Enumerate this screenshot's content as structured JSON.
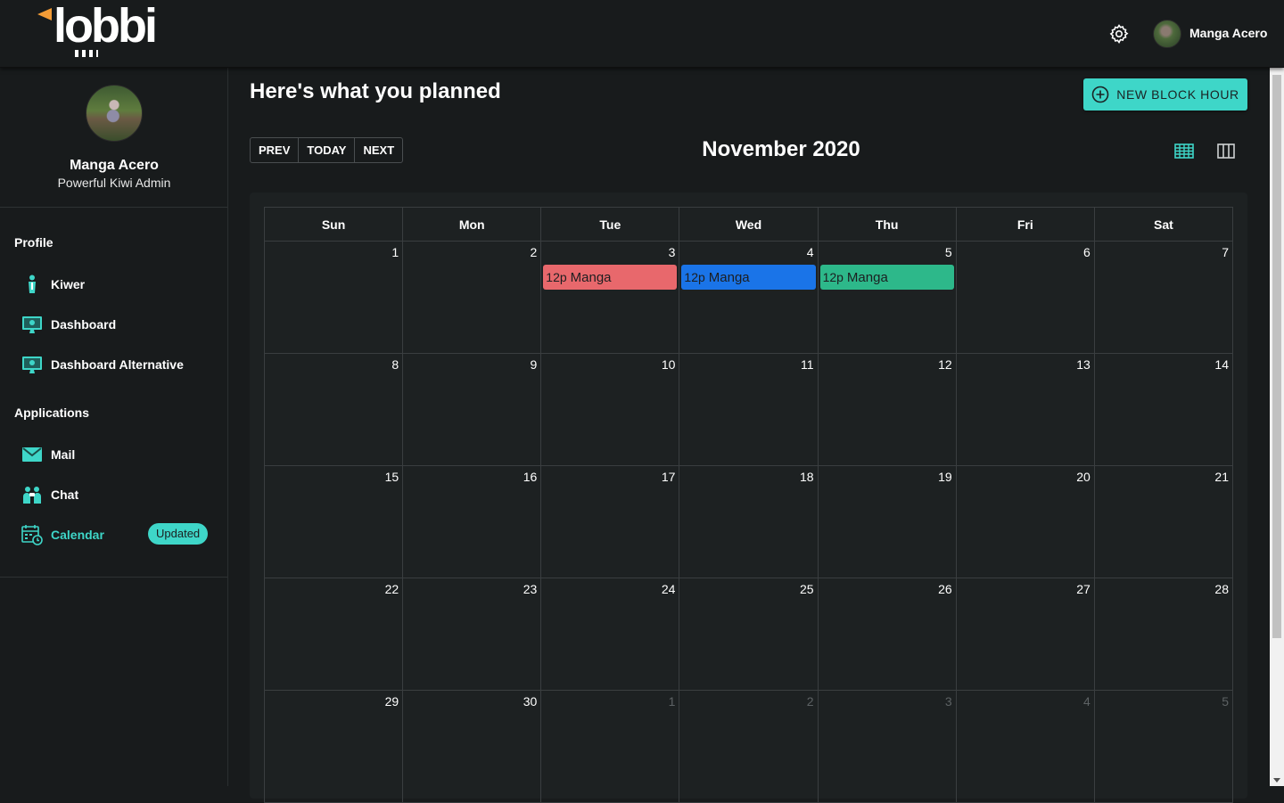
{
  "app": {
    "logo_text": "lobbi",
    "settings_icon": "gear-icon",
    "user_name": "Manga Acero",
    "accent": "#3ed6c8"
  },
  "sidebar": {
    "profile_name": "Manga Acero",
    "profile_role": "Powerful Kiwi Admin",
    "sections": [
      {
        "label": "Profile",
        "items": [
          {
            "label": "Kiwer",
            "icon": "person-icon"
          },
          {
            "label": "Dashboard",
            "icon": "monitor-icon"
          },
          {
            "label": "Dashboard Alternative",
            "icon": "monitor-icon"
          }
        ]
      },
      {
        "label": "Applications",
        "items": [
          {
            "label": "Mail",
            "icon": "mail-icon"
          },
          {
            "label": "Chat",
            "icon": "chat-users-icon"
          },
          {
            "label": "Calendar",
            "icon": "calendar-icon",
            "badge": "Updated",
            "active": true
          }
        ]
      }
    ]
  },
  "main": {
    "title": "Here's what you planned",
    "new_button": "NEW BLOCK HOUR",
    "nav": {
      "prev": "PREV",
      "today": "TODAY",
      "next": "NEXT"
    },
    "month_title": "November 2020",
    "views": [
      "month-grid-icon",
      "week-columns-icon"
    ]
  },
  "calendar": {
    "weekdays": [
      "Sun",
      "Mon",
      "Tue",
      "Wed",
      "Thu",
      "Fri",
      "Sat"
    ],
    "weeks": [
      [
        {
          "d": "1"
        },
        {
          "d": "2"
        },
        {
          "d": "3",
          "event": {
            "time": "12p",
            "title": "Manga",
            "color": "#e8686c"
          }
        },
        {
          "d": "4",
          "event": {
            "time": "12p",
            "title": "Manga",
            "color": "#1a74e8"
          }
        },
        {
          "d": "5",
          "event": {
            "time": "12p",
            "title": "Manga",
            "color": "#2db88a"
          }
        },
        {
          "d": "6"
        },
        {
          "d": "7"
        }
      ],
      [
        {
          "d": "8"
        },
        {
          "d": "9"
        },
        {
          "d": "10"
        },
        {
          "d": "11"
        },
        {
          "d": "12"
        },
        {
          "d": "13"
        },
        {
          "d": "14"
        }
      ],
      [
        {
          "d": "15"
        },
        {
          "d": "16"
        },
        {
          "d": "17"
        },
        {
          "d": "18"
        },
        {
          "d": "19"
        },
        {
          "d": "20"
        },
        {
          "d": "21"
        }
      ],
      [
        {
          "d": "22"
        },
        {
          "d": "23"
        },
        {
          "d": "24"
        },
        {
          "d": "25"
        },
        {
          "d": "26"
        },
        {
          "d": "27"
        },
        {
          "d": "28"
        }
      ],
      [
        {
          "d": "29"
        },
        {
          "d": "30"
        },
        {
          "d": "1",
          "other": true
        },
        {
          "d": "2",
          "other": true
        },
        {
          "d": "3",
          "other": true
        },
        {
          "d": "4",
          "other": true
        },
        {
          "d": "5",
          "other": true
        }
      ]
    ]
  }
}
